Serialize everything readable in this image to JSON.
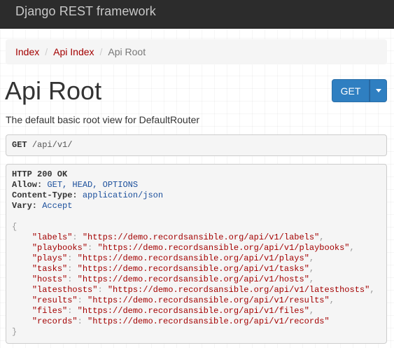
{
  "navbar": {
    "brand": "Django REST framework"
  },
  "breadcrumb": [
    {
      "label": "Index"
    },
    {
      "label": "Api Index"
    },
    {
      "label": "Api Root"
    }
  ],
  "page": {
    "title": "Api Root",
    "description": "The default basic root view for DefaultRouter"
  },
  "buttons": {
    "get_label": "GET"
  },
  "request": {
    "method": "GET",
    "path": "/api/v1/"
  },
  "response": {
    "status": "HTTP 200 OK",
    "headers": [
      {
        "name": "Allow:",
        "value": "GET, HEAD, OPTIONS"
      },
      {
        "name": "Content-Type:",
        "value": "application/json"
      },
      {
        "name": "Vary:",
        "value": "Accept"
      }
    ],
    "open_brace": "{",
    "close_brace": "}",
    "body": [
      {
        "key": "\"labels\"",
        "value": "\"https://demo.recordsansible.org/api/v1/labels\"",
        "trail": ","
      },
      {
        "key": "\"playbooks\"",
        "value": "\"https://demo.recordsansible.org/api/v1/playbooks\"",
        "trail": ","
      },
      {
        "key": "\"plays\"",
        "value": "\"https://demo.recordsansible.org/api/v1/plays\"",
        "trail": ","
      },
      {
        "key": "\"tasks\"",
        "value": "\"https://demo.recordsansible.org/api/v1/tasks\"",
        "trail": ","
      },
      {
        "key": "\"hosts\"",
        "value": "\"https://demo.recordsansible.org/api/v1/hosts\"",
        "trail": ","
      },
      {
        "key": "\"latesthosts\"",
        "value": "\"https://demo.recordsansible.org/api/v1/latesthosts\"",
        "trail": ","
      },
      {
        "key": "\"results\"",
        "value": "\"https://demo.recordsansible.org/api/v1/results\"",
        "trail": ","
      },
      {
        "key": "\"files\"",
        "value": "\"https://demo.recordsansible.org/api/v1/files\"",
        "trail": ","
      },
      {
        "key": "\"records\"",
        "value": "\"https://demo.recordsansible.org/api/v1/records\"",
        "trail": ""
      }
    ]
  },
  "colors": {
    "navbar_bg": "#2c2c2c",
    "link": "#a30000",
    "primary_button": "#2f7fc1",
    "header_value": "#1b4f9c"
  },
  "icons": {
    "dropdown": "caret-down-icon"
  }
}
